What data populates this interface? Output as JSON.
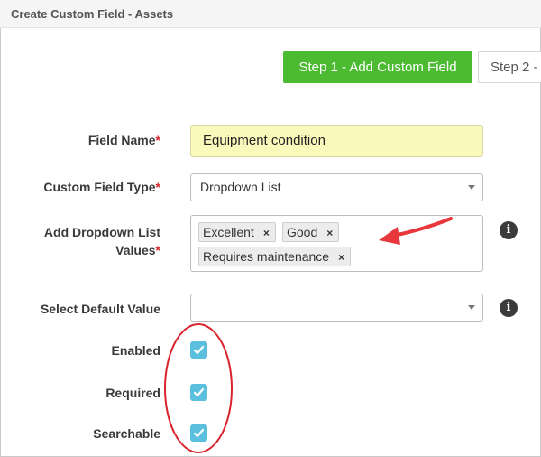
{
  "header": {
    "title": "Create Custom Field - Assets"
  },
  "steps": {
    "step1_label": "Step 1 - Add Custom Field",
    "step2_label": "Step 2 -"
  },
  "form": {
    "field_name": {
      "label": "Field Name",
      "required_mark": "*",
      "value": "Equipment condition"
    },
    "field_type": {
      "label": "Custom Field Type",
      "required_mark": "*",
      "value": "Dropdown List"
    },
    "dropdown_values": {
      "label_line1": "Add Dropdown List",
      "label_line2": "Values",
      "required_mark": "*",
      "tags": [
        "Excellent",
        "Good",
        "Requires maintenance"
      ],
      "remove_glyph": "×"
    },
    "default_value": {
      "label": "Select Default Value",
      "value": ""
    },
    "enabled": {
      "label": "Enabled",
      "checked": true
    },
    "required": {
      "label": "Required",
      "checked": true
    },
    "searchable": {
      "label": "Searchable",
      "checked": true
    }
  },
  "info_icon_glyph": "i",
  "annotation_colors": {
    "arrow": "#e8383d",
    "ellipse": "#d9232d"
  },
  "colors": {
    "accent_green": "#4cbb32",
    "checkbox_blue": "#5bc0de",
    "highlight_input": "#fbf8bb"
  }
}
